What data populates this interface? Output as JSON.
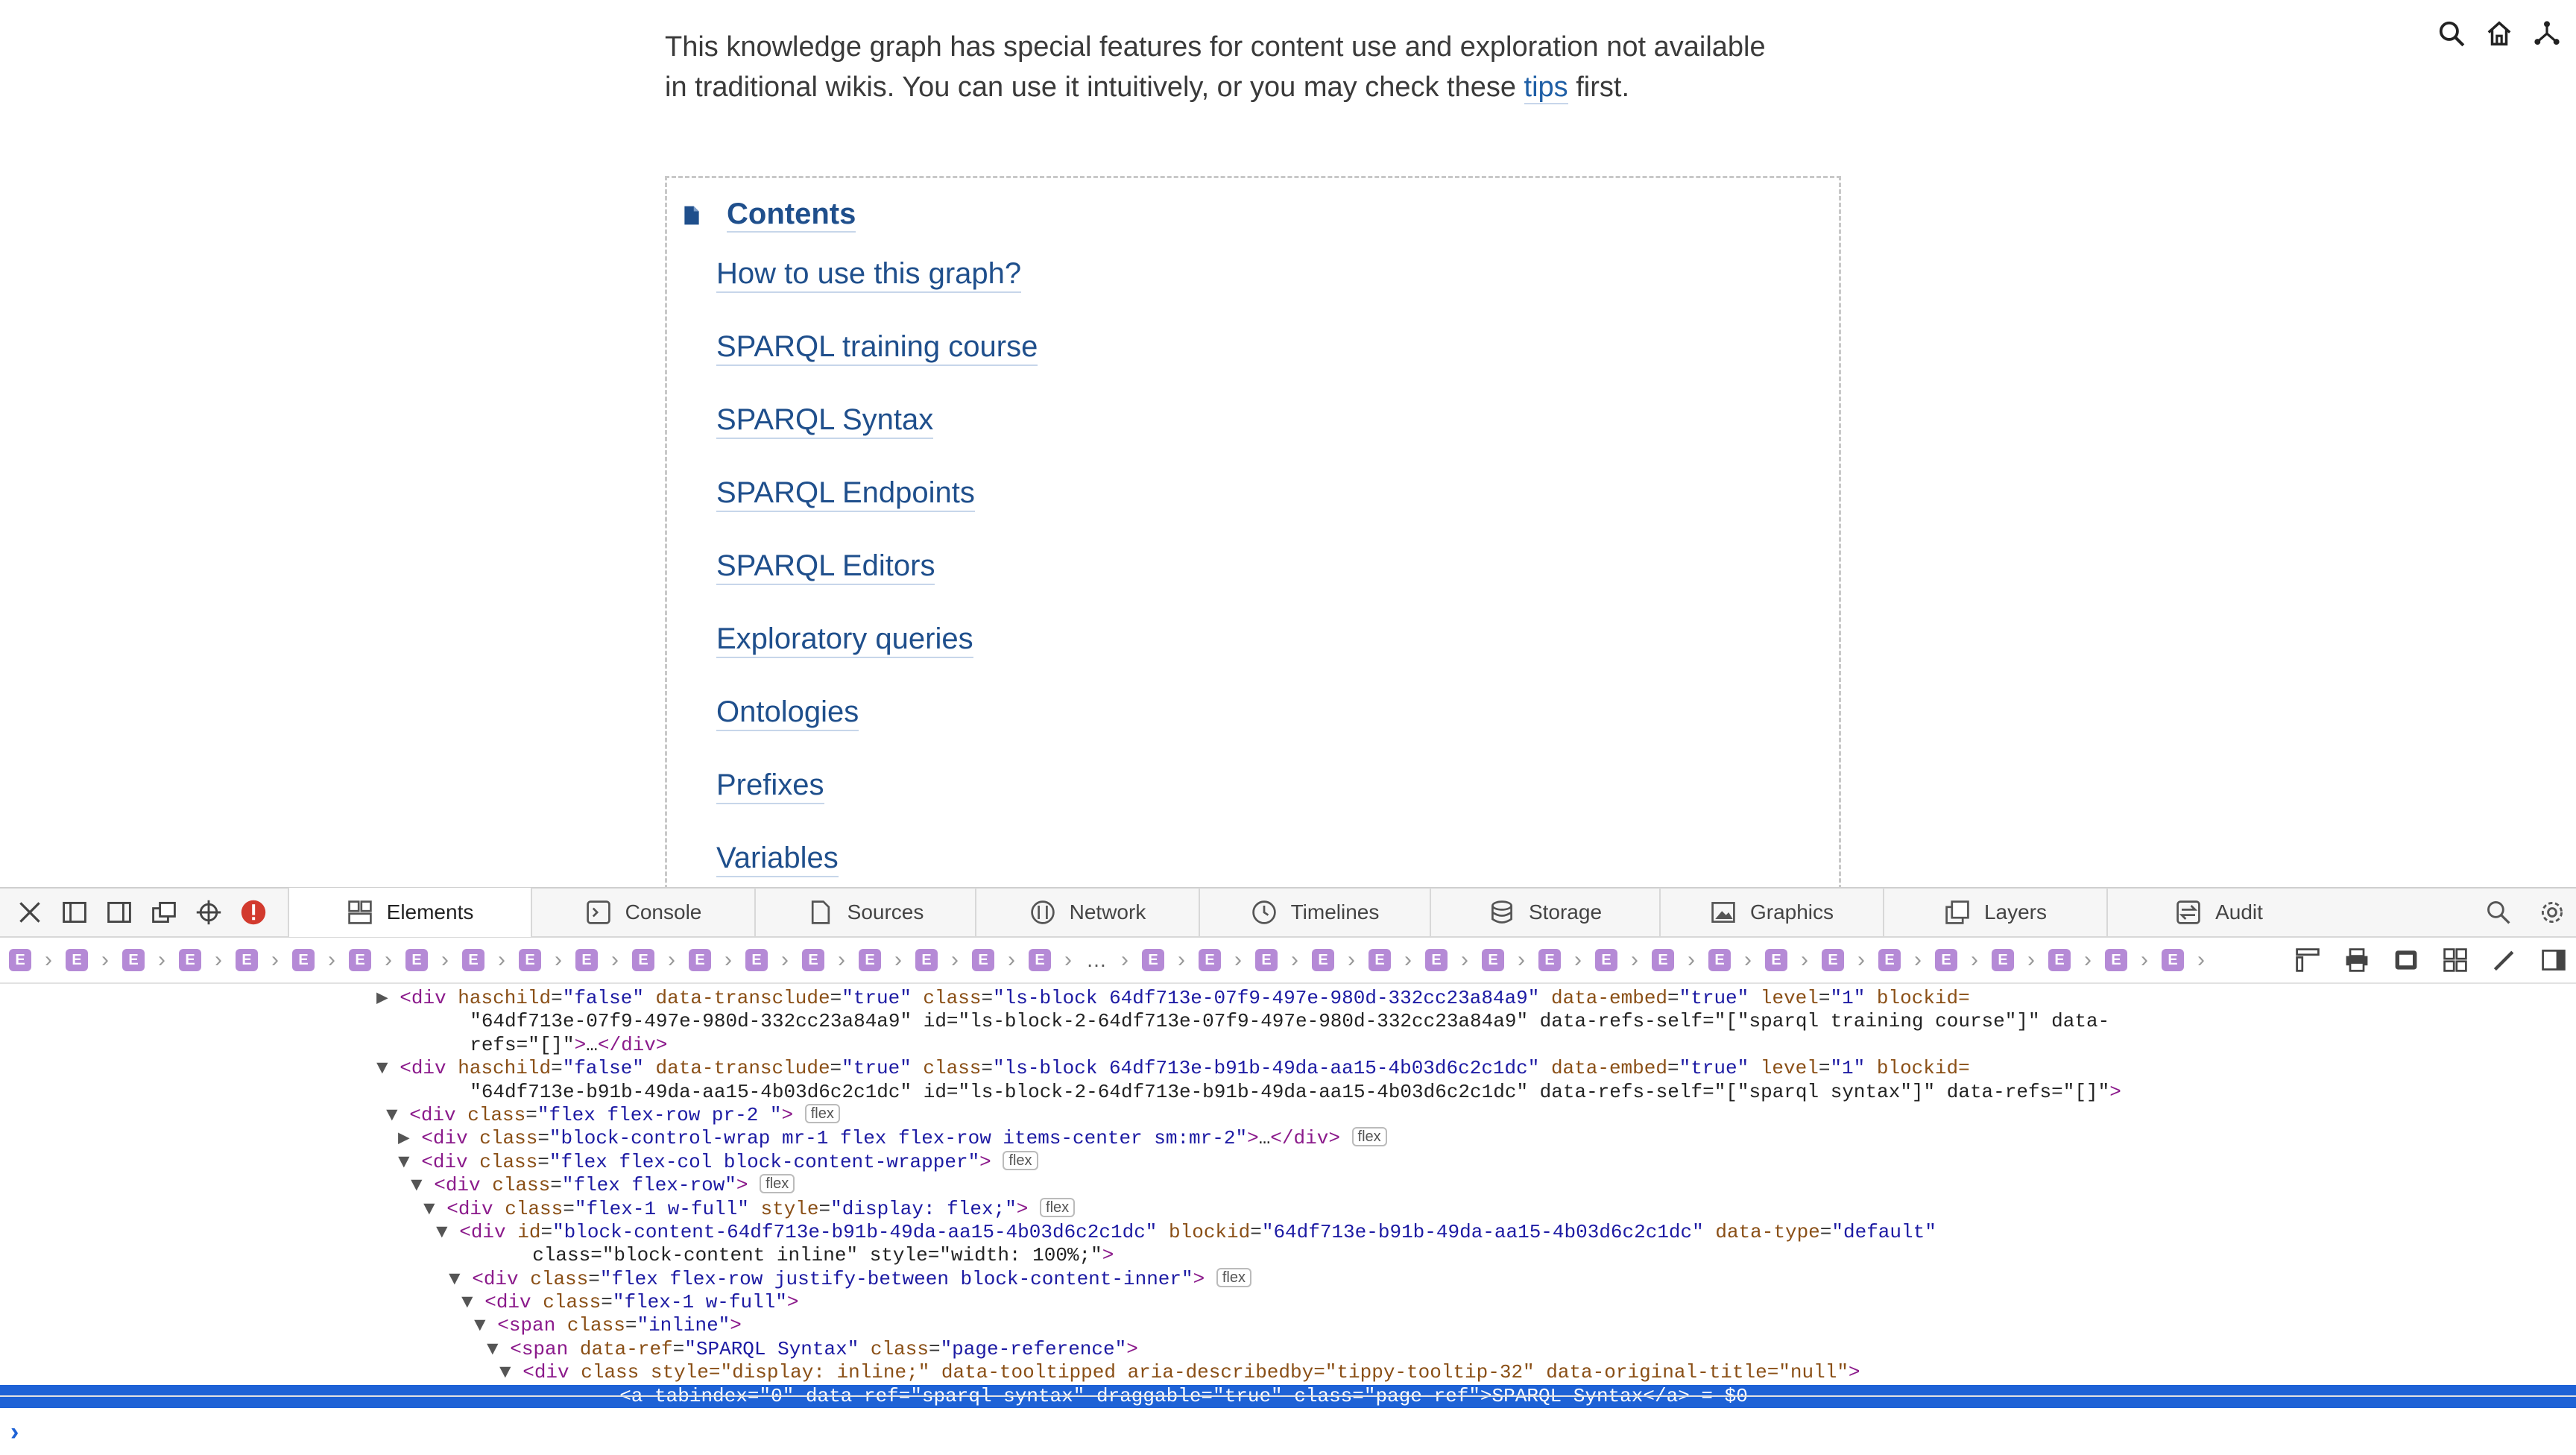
{
  "page": {
    "intro_line1": "This knowledge graph has special features for content use and exploration not available",
    "intro_line2_prefix": "in traditional wikis. You can use it intuitively, or you may check these ",
    "intro_link": "tips",
    "intro_line2_suffix": " first.",
    "contents_title": "Contents",
    "toc": [
      "How to use this graph?",
      "SPARQL training course",
      "SPARQL Syntax",
      "SPARQL Endpoints",
      "SPARQL Editors",
      "Exploratory queries",
      "Ontologies",
      "Prefixes",
      "Variables"
    ]
  },
  "header_icons": [
    "search-icon",
    "home-icon",
    "graph-icon"
  ],
  "devtools": {
    "tabs": [
      "Elements",
      "Console",
      "Sources",
      "Network",
      "Timelines",
      "Storage",
      "Graphics",
      "Layers",
      "Audit"
    ],
    "active_tab": "Elements",
    "breadcrumb_glyph": "E",
    "breadcrumb_ellipsis": "…",
    "selected_suffix": " = $0",
    "badge": "flex",
    "colors": {
      "tag": "#8b1a8b",
      "attr_name": "#8a4f16",
      "attr_value": "#1c1aa3",
      "selection": "#1e62d6"
    }
  },
  "dom_lines": [
    "<div haschild=\"false\" data-transclude=\"true\" class=\"ls-block 64df713e-07f9-497e-980d-332cc23a84a9\" data-embed=\"true\" level=\"1\" blockid=",
    "\"64df713e-07f9-497e-980d-332cc23a84a9\" id=\"ls-block-2-64df713e-07f9-497e-980d-332cc23a84a9\" data-refs-self=\"[\"sparql training course\"]\" data-",
    "refs=\"[]\">…</div>",
    "<div haschild=\"false\" data-transclude=\"true\" class=\"ls-block 64df713e-b91b-49da-aa15-4b03d6c2c1dc\" data-embed=\"true\" level=\"1\" blockid=",
    "\"64df713e-b91b-49da-aa15-4b03d6c2c1dc\" id=\"ls-block-2-64df713e-b91b-49da-aa15-4b03d6c2c1dc\" data-refs-self=\"[\"sparql syntax\"]\" data-refs=\"[]\">",
    "<div class=\"flex flex-row pr-2 \">",
    "<div class=\"block-control-wrap mr-1 flex flex-row items-center sm:mr-2\">…</div>",
    "<div class=\"flex flex-col block-content-wrapper\">",
    "<div class=\"flex flex-row\">",
    "<div class=\"flex-1 w-full\" style=\"display: flex;\">",
    "<div id=\"block-content-64df713e-b91b-49da-aa15-4b03d6c2c1dc\" blockid=\"64df713e-b91b-49da-aa15-4b03d6c2c1dc\" data-type=\"default\"",
    "class=\"block-content inline\" style=\"width: 100%;\">",
    "<div class=\"flex flex-row justify-between block-content-inner\">",
    "<div class=\"flex-1 w-full\">",
    "<span class=\"inline\">",
    "<span data-ref=\"SPARQL Syntax\" class=\"page-reference\">",
    "<div class style=\"display: inline;\" data-tooltipped aria-describedby=\"tippy-tooltip-32\" data-original-title=\"null\">",
    "<a tabindex=\"0\" data-ref=\"sparql syntax\" draggable=\"true\" class=\"page-ref\">SPARQL Syntax</a>"
  ]
}
